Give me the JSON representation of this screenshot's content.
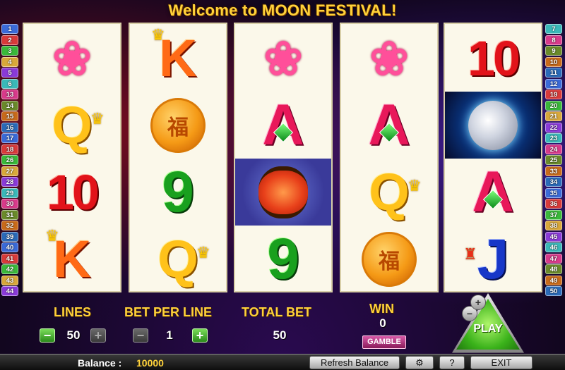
{
  "title": "Welcome to MOON FESTIVAL!",
  "paylines_left": [
    "1",
    "2",
    "3",
    "4",
    "5",
    "6",
    "13",
    "14",
    "15",
    "16",
    "17",
    "18",
    "26",
    "27",
    "28",
    "29",
    "30",
    "31",
    "32",
    "39",
    "40",
    "41",
    "42",
    "43",
    "44"
  ],
  "paylines_right": [
    "7",
    "8",
    "9",
    "10",
    "11",
    "12",
    "19",
    "20",
    "21",
    "22",
    "23",
    "24",
    "25",
    "33",
    "34",
    "35",
    "36",
    "37",
    "38",
    "45",
    "46",
    "47",
    "48",
    "49",
    "50"
  ],
  "payline_colors": [
    "#3a6ad8",
    "#d83a3a",
    "#3ab83a",
    "#d8a83a",
    "#8a3ad8",
    "#3ab8b8",
    "#d83a8a",
    "#6a8a2a",
    "#c86a1a",
    "#2a6ab8"
  ],
  "reels": [
    [
      {
        "symbol": "lotus-icon",
        "text": "❀"
      },
      {
        "symbol": "queen",
        "text": "Q"
      },
      {
        "symbol": "ten",
        "text": "10"
      },
      {
        "symbol": "king",
        "text": "K"
      }
    ],
    [
      {
        "symbol": "king",
        "text": "K"
      },
      {
        "symbol": "mooncake-icon",
        "text": "福"
      },
      {
        "symbol": "nine",
        "text": "9"
      },
      {
        "symbol": "queen",
        "text": "Q"
      }
    ],
    [
      {
        "symbol": "lotus-icon",
        "text": "❀"
      },
      {
        "symbol": "ace",
        "text": "A"
      },
      {
        "symbol": "lantern-icon",
        "text": ""
      },
      {
        "symbol": "nine",
        "text": "9"
      }
    ],
    [
      {
        "symbol": "lotus-icon",
        "text": "❀"
      },
      {
        "symbol": "ace",
        "text": "A"
      },
      {
        "symbol": "queen",
        "text": "Q"
      },
      {
        "symbol": "mooncake-icon",
        "text": "福"
      }
    ],
    [
      {
        "symbol": "ten",
        "text": "10"
      },
      {
        "symbol": "moon-icon",
        "text": ""
      },
      {
        "symbol": "ace",
        "text": "A"
      },
      {
        "symbol": "jack",
        "text": "J"
      }
    ]
  ],
  "controls": {
    "lines_label": "LINES",
    "lines_value": "50",
    "bet_per_line_label": "BET PER LINE",
    "bet_per_line_value": "1",
    "total_bet_label": "TOTAL BET",
    "total_bet_value": "50",
    "win_label": "WIN",
    "win_value": "0",
    "gamble_label": "GAMBLE",
    "play_label": "PLAY",
    "minus": "−",
    "plus": "+"
  },
  "bottom": {
    "balance_label": "Balance :",
    "balance_value": "10000",
    "refresh_label": "Refresh Balance",
    "settings_icon": "⚙",
    "help_label": "?",
    "exit_label": "EXIT"
  }
}
